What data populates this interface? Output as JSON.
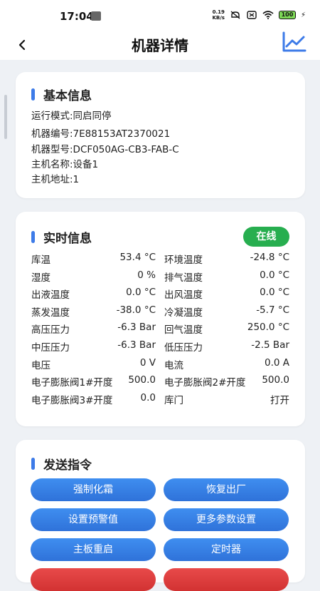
{
  "status_bar": {
    "time": "17:04",
    "net_speed_value": "0.19",
    "net_speed_unit": "KB/s",
    "battery": "100"
  },
  "header": {
    "title": "机器详情"
  },
  "basic_info": {
    "title": "基本信息",
    "lines": [
      "运行模式:同启同停",
      "机器编号:7E88153AT2370021",
      "机器型号:DCF050AG-CB3-FAB-C",
      "主机名称:设备1",
      "主机地址:1"
    ]
  },
  "realtime": {
    "title": "实时信息",
    "status": "在线",
    "status_color": "#27ae4f",
    "rows": [
      {
        "l_label": "库温",
        "l_value": "53.4 °C",
        "r_label": "环境温度",
        "r_value": "-24.8 °C"
      },
      {
        "l_label": "湿度",
        "l_value": "0 %",
        "r_label": "排气温度",
        "r_value": "0.0 °C"
      },
      {
        "l_label": "出液温度",
        "l_value": "0.0 °C",
        "r_label": "出风温度",
        "r_value": "0.0 °C"
      },
      {
        "l_label": "蒸发温度",
        "l_value": "-38.0 °C",
        "r_label": "冷凝温度",
        "r_value": "-5.7 °C"
      },
      {
        "l_label": "高压压力",
        "l_value": "-6.3 Bar",
        "r_label": "回气温度",
        "r_value": "250.0 °C"
      },
      {
        "l_label": "中压压力",
        "l_value": "-6.3 Bar",
        "r_label": "低压压力",
        "r_value": "-2.5 Bar"
      },
      {
        "l_label": "电压",
        "l_value": "0 V",
        "r_label": "电流",
        "r_value": "0.0 A"
      },
      {
        "l_label": "电子膨胀阀1#开度",
        "l_value": "500.0",
        "r_label": "电子膨胀阀2#开度",
        "r_value": "500.0"
      },
      {
        "l_label": "电子膨胀阀3#开度",
        "l_value": "0.0",
        "r_label": "库门",
        "r_value": "打开"
      }
    ]
  },
  "commands": {
    "title": "发送指令",
    "buttons": [
      "强制化霜",
      "恢复出厂",
      "设置预警值",
      "更多参数设置",
      "主板重启",
      "定时器"
    ],
    "accent_color": "#3d7be8",
    "button_color": "#3a86ec",
    "danger_color": "#e04343"
  }
}
